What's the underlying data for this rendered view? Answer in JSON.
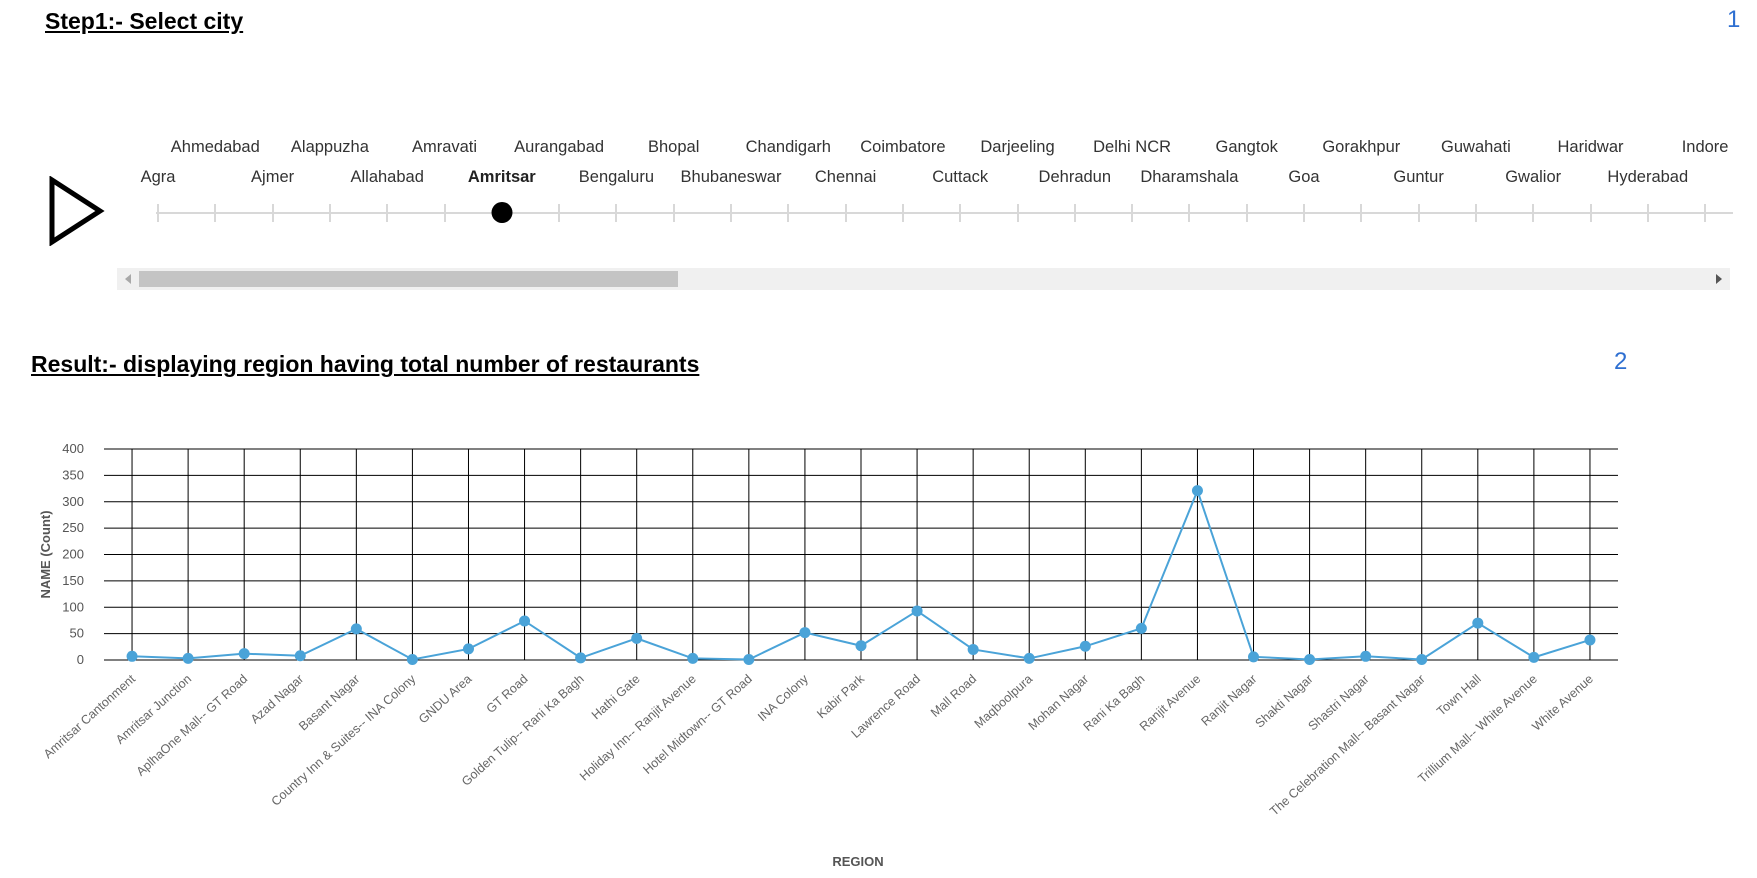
{
  "step": {
    "title": "Step1:- Select city",
    "number": "1"
  },
  "result": {
    "title": "Result:- displaying region having total number of restaurants",
    "number": "2"
  },
  "play_icon": "play-icon",
  "slider": {
    "cities": [
      "Agra",
      "Ahmedabad",
      "Ajmer",
      "Alappuzha",
      "Allahabad",
      "Amravati",
      "Amritsar",
      "Aurangabad",
      "Bengaluru",
      "Bhopal",
      "Bhubaneswar",
      "Chandigarh",
      "Chennai",
      "Coimbatore",
      "Cuttack",
      "Darjeeling",
      "Dehradun",
      "Delhi NCR",
      "Dharamshala",
      "Gangtok",
      "Goa",
      "Gorakhpur",
      "Guntur",
      "Guwahati",
      "Gwalior",
      "Haridwar",
      "Hyderabad",
      "Indore"
    ],
    "selected": "Amritsar",
    "selected_index": 6,
    "scroll_fraction": 0.33
  },
  "colors": {
    "line": "#4aa3d8",
    "point": "#4aa3d8",
    "grid": "#000000",
    "title_accent": "#2e6fd1"
  },
  "chart_data": {
    "type": "line",
    "xlabel": "REGION",
    "ylabel": "NAME (Count)",
    "ylim": [
      0,
      400
    ],
    "yticks": [
      0,
      50,
      100,
      150,
      200,
      250,
      300,
      350,
      400
    ],
    "grid": true,
    "categories": [
      "Amritsar Cantonment",
      "Amritsar Junction",
      "AplhaOne Mall-- GT Road",
      "Azad Nagar",
      "Basant Nagar",
      "Country Inn & Suites-- INA Colony",
      "GNDU Area",
      "GT Road",
      "Golden Tulip-- Rani Ka Bagh",
      "Hathi Gate",
      "Holiday Inn-- Ranjit Avenue",
      "Hotel Midtown-- GT Road",
      "INA Colony",
      "Kabir Park",
      "Lawrence Road",
      "Mall Road",
      "Maqboolpura",
      "Mohan Nagar",
      "Rani Ka Bagh",
      "Ranjit Avenue",
      "Ranjit Nagar",
      "Shakti Nagar",
      "Shastri Nagar",
      "The Celebration Mall-- Basant Nagar",
      "Town Hall",
      "Trillium Mall-- White Avenue",
      "White Avenue"
    ],
    "values": [
      7,
      3,
      12,
      8,
      59,
      1,
      21,
      74,
      4,
      41,
      3,
      1,
      52,
      27,
      93,
      20,
      3,
      26,
      60,
      321,
      6,
      1,
      7,
      1,
      70,
      5,
      38
    ]
  }
}
